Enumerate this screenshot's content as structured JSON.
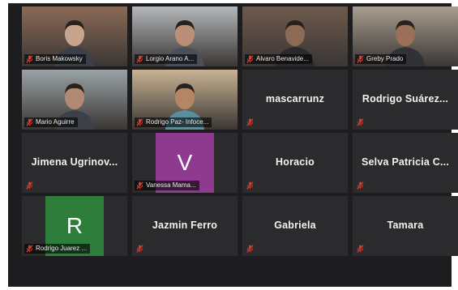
{
  "participants": [
    {
      "label": "Boris Makowsky",
      "type": "video",
      "bg": "#8a6a55",
      "skin": "#c9a48c",
      "shirt": "#3a3f4a"
    },
    {
      "label": "Lorgio Arano A...",
      "type": "video",
      "bg": "#b4b8ba",
      "skin": "#b98f78",
      "shirt": "#4a4f5a"
    },
    {
      "label": "Alvaro Benavide...",
      "type": "video",
      "bg": "#6e5a4c",
      "skin": "#8c6a55",
      "shirt": "#2a2a2e"
    },
    {
      "label": "Greby Prado",
      "type": "video",
      "bg": "#a89e90",
      "skin": "#9a7058",
      "shirt": "#303238"
    },
    {
      "label": "Mario Aguirre",
      "type": "video",
      "bg": "#9aa3a6",
      "skin": "#b08a72",
      "shirt": "#3c4048"
    },
    {
      "label": "Rodrigo Paz- Infoce...",
      "type": "video",
      "active": true,
      "bg": "#c9b394",
      "skin": "#b58666",
      "shirt": "#5a8fa0"
    },
    {
      "name": "mascarrunz",
      "type": "name"
    },
    {
      "name": "Rodrigo Suárez...",
      "type": "name"
    },
    {
      "name": "Jimena Ugrinov...",
      "type": "name"
    },
    {
      "label": "Vanessa Mama...",
      "initial": "V",
      "type": "avatar",
      "avatar_color": "#8e3a8e"
    },
    {
      "name": "Horacio",
      "type": "name"
    },
    {
      "name": "Selva Patricia C...",
      "type": "name"
    },
    {
      "label": "Rodrigo Juarez ...",
      "initial": "R",
      "type": "avatar",
      "avatar_color": "#2f7d3a"
    },
    {
      "name": "Jazmin Ferro",
      "type": "name"
    },
    {
      "name": "Gabriela",
      "type": "name"
    },
    {
      "name": "Tamara",
      "type": "name"
    }
  ],
  "colors": {
    "muted_mic": "#e0392b",
    "active_border": "#c7d94a",
    "tile_bg": "#2b2b2d",
    "screen_bg": "#1d1d1f"
  }
}
